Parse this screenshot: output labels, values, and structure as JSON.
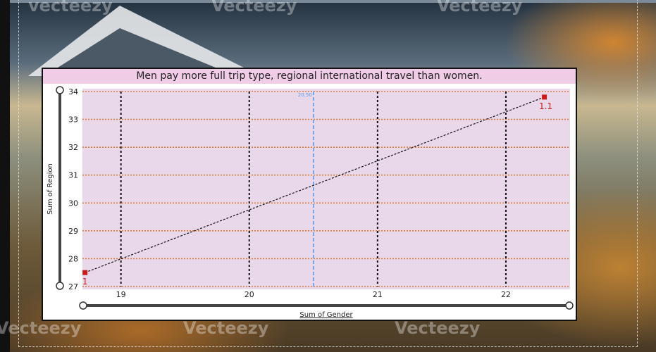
{
  "watermarks": [
    "vecteezy",
    "Vecteezy",
    "Vecteezy",
    "Vecteezy",
    "Vecteezy",
    "Vecteezy"
  ],
  "chart": {
    "title": "Men pay more full trip type, regional international travel than women.",
    "xlabel": "Sum of Gender",
    "ylabel": "Sum of Region",
    "average_line_label": "20.50"
  },
  "colors": {
    "plot_bg": "#e8d8ea",
    "title_bg": "#f0cce6",
    "grid_h": "#e07a3a",
    "grid_v": "#111111",
    "marker": "#cc1a1a",
    "average_line": "#5a9cf0"
  },
  "chart_data": {
    "type": "scatter",
    "title": "Men pay more full trip type, regional international travel than women.",
    "xlabel": "Sum of Gender",
    "ylabel": "Sum of Region",
    "xlim": [
      18.7,
      22.5
    ],
    "ylim": [
      27,
      34
    ],
    "x_ticks": [
      19,
      20,
      21,
      22
    ],
    "y_ticks": [
      27,
      28,
      29,
      30,
      31,
      32,
      33,
      34
    ],
    "points": [
      {
        "x": 18.72,
        "y": 27.5,
        "label": "1"
      },
      {
        "x": 22.3,
        "y": 33.8,
        "label": "1.1"
      }
    ],
    "trend_line": {
      "from": [
        18.72,
        27.5
      ],
      "to": [
        22.3,
        33.8
      ]
    },
    "x_average_line": 20.5,
    "grid": true
  }
}
